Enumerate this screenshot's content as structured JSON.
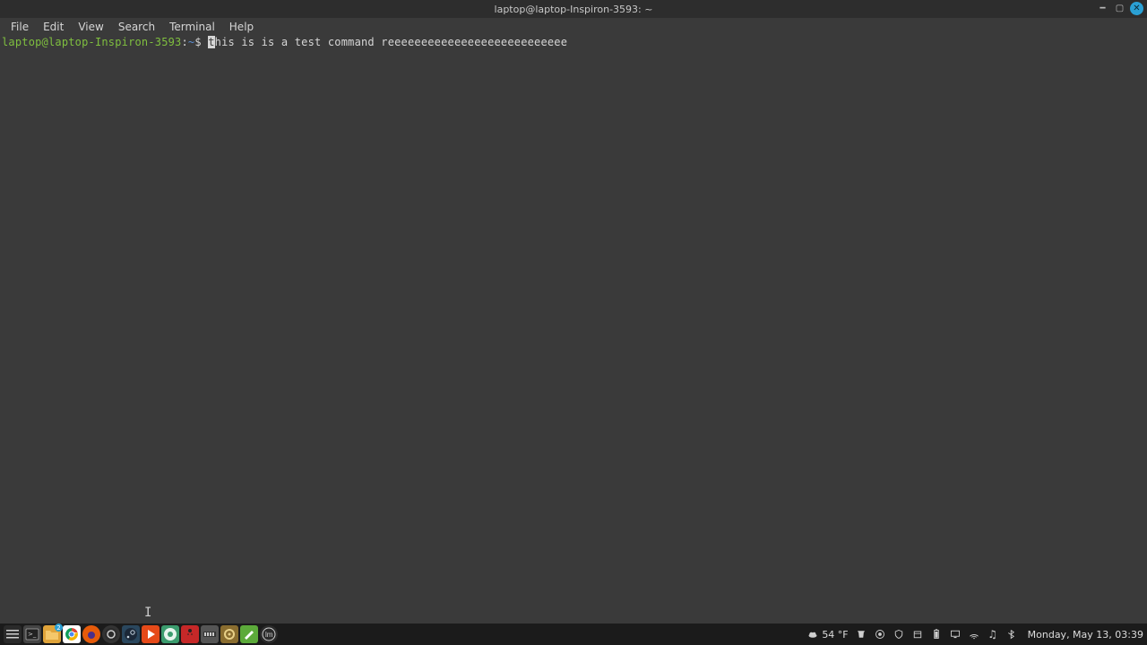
{
  "window": {
    "title": "laptop@laptop-Inspiron-3593: ~"
  },
  "menubar": {
    "items": [
      "File",
      "Edit",
      "View",
      "Search",
      "Terminal",
      "Help"
    ]
  },
  "terminal": {
    "prompt": {
      "userhost": "laptop@laptop-Inspiron-3593",
      "sep": ":",
      "path": "~",
      "symbol": "$"
    },
    "cursor_char": "t",
    "command_after_cursor": "his is is a test command reeeeeeeeeeeeeeeeeeeeeeeeeee"
  },
  "taskbar": {
    "app_icons": [
      {
        "name": "menu-icon",
        "color": "#cfcfcf"
      },
      {
        "name": "terminal-app-icon",
        "color": "#cfcfcf"
      },
      {
        "name": "files-app-icon",
        "color": "#e0a43a",
        "badge": "2"
      },
      {
        "name": "chrome-app-icon",
        "color": "#4a8af4"
      },
      {
        "name": "firefox-app-icon",
        "color": "#e65b0a"
      },
      {
        "name": "obs-app-icon",
        "color": "#333"
      },
      {
        "name": "steam-app-icon",
        "color": "#2a475e"
      },
      {
        "name": "media-app-icon",
        "color": "#e64a19"
      },
      {
        "name": "vscode-app-icon",
        "color": "#3b9c6e"
      },
      {
        "name": "ladybug-app-icon",
        "color": "#c62828"
      },
      {
        "name": "kdenlive-app-icon",
        "color": "#555"
      },
      {
        "name": "gear-app-icon",
        "color": "#8a6d2f"
      },
      {
        "name": "editor-app-icon",
        "color": "#5caa3a"
      },
      {
        "name": "mint-app-icon",
        "color": "#7fbf3f"
      }
    ],
    "weather": {
      "icon": "cloud-icon",
      "temp": "54 °F"
    },
    "tray_icons": [
      "trash-icon",
      "record-icon",
      "shield-icon",
      "package-icon",
      "battery-icon",
      "monitor-icon",
      "network-icon",
      "audio-icon",
      "bluetooth-icon"
    ],
    "clock": "Monday, May 13, 03:39"
  }
}
